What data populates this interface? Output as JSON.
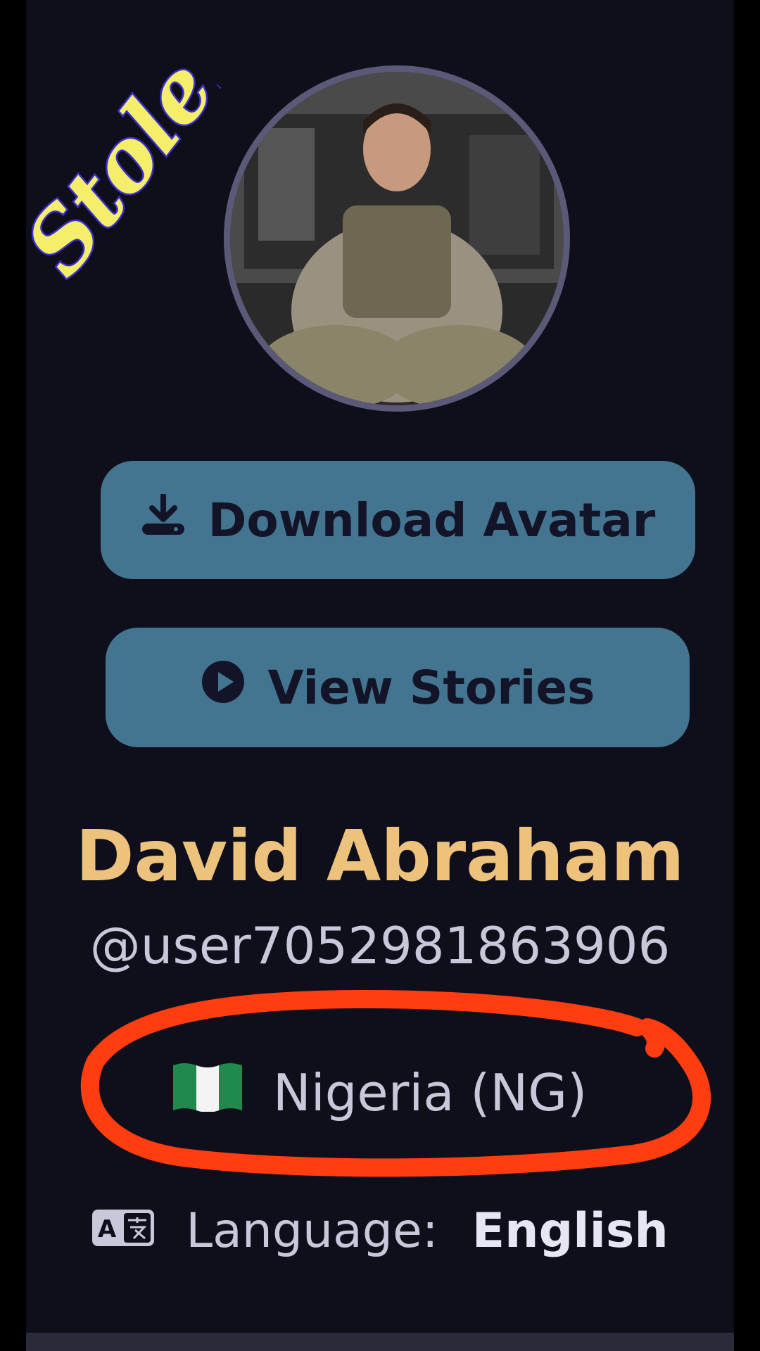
{
  "watermark": {
    "text": "Stolen"
  },
  "profile": {
    "name": "David Abraham",
    "handle": "@user7052981863906",
    "country": "Nigeria (NG)",
    "language_label": "Language:",
    "language_value": "English"
  },
  "buttons": {
    "download_label": "Download Avatar",
    "stories_label": "View Stories"
  },
  "icons": {
    "download": "download-icon",
    "play": "play-circle-icon",
    "flag": "nigeria-flag-icon",
    "translate": "translate-icon"
  },
  "colors": {
    "background": "#0f0f1c",
    "button": "#437590",
    "name": "#ecc27c",
    "annotation_circle": "#ff3d10",
    "watermark": "#f4ee6a"
  }
}
